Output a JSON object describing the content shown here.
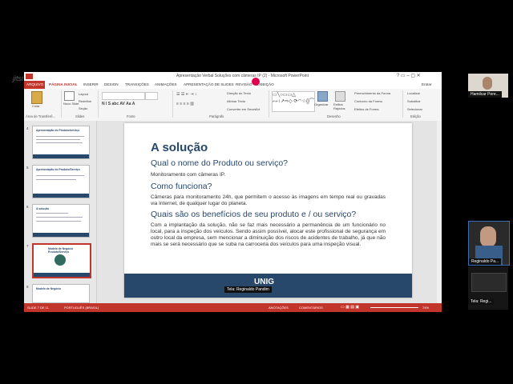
{
  "window": {
    "title": "Apresentação Verbal Soluções com câmeras IP (2) - Microsoft PowerPoint",
    "tabs": [
      "ARQUIVO",
      "PÁGINA INICIAL",
      "INSERIR",
      "DESIGN",
      "TRANSIÇÕES",
      "ANIMAÇÕES",
      "APRESENTAÇÃO DE SLIDES",
      "REVISÃO",
      "EXIBIÇÃO"
    ],
    "user": "Entrar"
  },
  "ribbon": {
    "paste": "Colar",
    "new_slide": "Novo Slide",
    "layout": "Layout",
    "reset": "Redefinir",
    "section": "Seção",
    "group_clipboard": "Área de Transferê...",
    "group_slides": "Slides",
    "group_font": "Fonte",
    "group_paragraph": "Parágrafo",
    "group_drawing": "Desenho",
    "group_editing": "Edição",
    "text_direction": "Direção do Texto",
    "align_text": "Alinhar Texto",
    "convert_smartart": "Converter em SmartArt",
    "arrange": "Organizar",
    "quick_styles": "Estilos Rápidos",
    "shape_fill": "Preenchimento da Forma",
    "shape_outline": "Contorno da Forma",
    "shape_effects": "Efeitos de Forma",
    "find": "Localizar",
    "replace": "Substituir",
    "select": "Selecionar"
  },
  "thumbnails": [
    {
      "num": "4",
      "title": "Apresentação do Produto/serviço"
    },
    {
      "num": "5",
      "title": "Apresentação do Produto/Serviço"
    },
    {
      "num": "6",
      "title": "A solução"
    },
    {
      "num": "7",
      "title": "Modelo de Negócio Produto/Serviço"
    },
    {
      "num": "8",
      "title": "Modelo de Negócio"
    }
  ],
  "slide": {
    "heading": "A solução",
    "q1": "Qual o nome do Produto ou serviço?",
    "a1": "Monitoramento com câmeras IP.",
    "q2": "Como funciona?",
    "a2": "Câmeras para monitoramento 24h, que permitem o acesso às imagens em tempo real ou gravadas via Internet, de qualquer lugar do planeta.",
    "q3": "Quais são os benefícios de seu produto e / ou serviço?",
    "a3": "Com a implantação da solução, não se faz mais necessário a permanência de um funcionário no local, para a inspeção dos veículos. Sendo assim possível, alocar este profissional de segurança em outro local da empresa, sem mencionar a diminuição dos riscos de acidentes de trabalho, já que não mais se será necessário que se suba na carroceria dos veículos para uma inspeção visual.",
    "footer_logo": "UNIG"
  },
  "status": {
    "slide_info": "SLIDE 7 DE 11",
    "language": "PORTUGUÊS (BRASIL)",
    "notes": "ANOTAÇÕES",
    "comments": "COMENTÁRIOS",
    "zoom": "74%"
  },
  "screen_share_label": "Tela: Reginaldo Pandim",
  "participants": [
    {
      "name": "Hamilcar Pere..."
    },
    {
      "name": "Reginaldo Pa..."
    },
    {
      "name": "Tela: Regi..."
    }
  ],
  "watermark": "jitsi"
}
